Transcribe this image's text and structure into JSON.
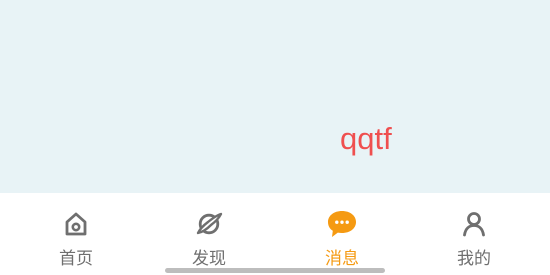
{
  "content": {
    "text": "qqtf"
  },
  "tabbar": {
    "tabs": [
      {
        "label": "首页",
        "icon": "home-icon",
        "active": false
      },
      {
        "label": "发现",
        "icon": "planet-icon",
        "active": false
      },
      {
        "label": "消息",
        "icon": "chat-bubble-icon",
        "active": true
      },
      {
        "label": "我的",
        "icon": "person-icon",
        "active": false
      }
    ]
  },
  "colors": {
    "content_background": "#e8f3f6",
    "content_text": "#ef4f4f",
    "active": "#f59a12",
    "inactive": "#6f6f6f"
  }
}
